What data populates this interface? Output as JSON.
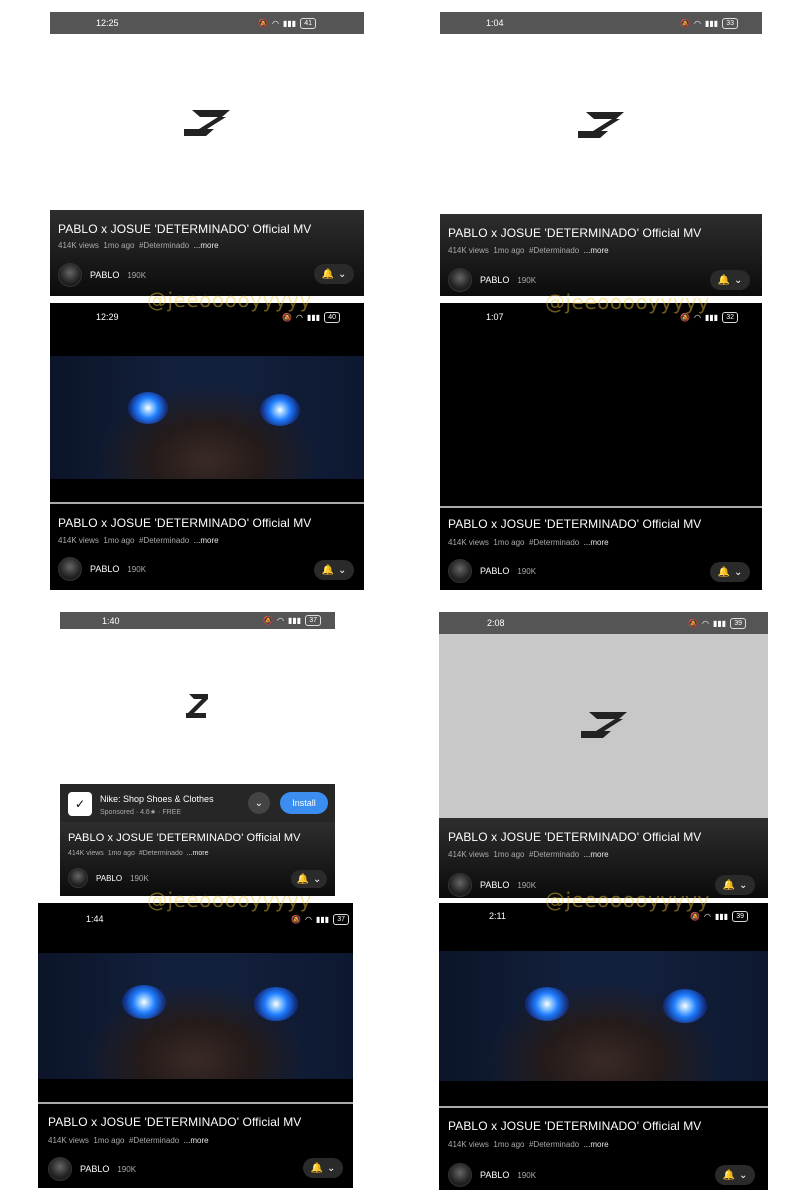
{
  "video": {
    "title": "PABLO x JOSUE 'DETERMINADO' Official MV",
    "views": "414K views",
    "age": "1mo ago",
    "hashtag": "#Determinado",
    "more": "...more",
    "channel": "PABLO",
    "subscribers": "190K"
  },
  "watermark": "@jeeooooyyyyy",
  "ad": {
    "app_name": "Nike: Shop Shoes & Clothes",
    "sponsored": "Sponsored",
    "rating": "4.6★",
    "price": "FREE",
    "install_label": "Install"
  },
  "icons": {
    "logo": "z-logo-icon",
    "bell": "bell-icon",
    "chevron": "chevron-down-icon",
    "status": [
      "mute-icon",
      "wifi-icon",
      "signal-icon",
      "battery-icon"
    ]
  },
  "panels": [
    {
      "status_top": {
        "time": "12:25",
        "battery": "41"
      },
      "status_bottom": {
        "time": "12:29",
        "battery": "40"
      }
    },
    {
      "status_top": {
        "time": "1:04",
        "battery": "33"
      },
      "status_bottom": {
        "time": "1:07",
        "battery": "32"
      }
    },
    {
      "status_top": {
        "time": "1:40",
        "battery": "37"
      },
      "status_bottom": {
        "time": "1:44",
        "battery": "37"
      }
    },
    {
      "status_top": {
        "time": "2:08",
        "battery": "39"
      },
      "status_bottom": {
        "time": "2:11",
        "battery": "39"
      }
    }
  ],
  "colors": {
    "accent": "#3b8ef0",
    "watermark": "#f5c83c",
    "eyes": "#1f7dff"
  }
}
